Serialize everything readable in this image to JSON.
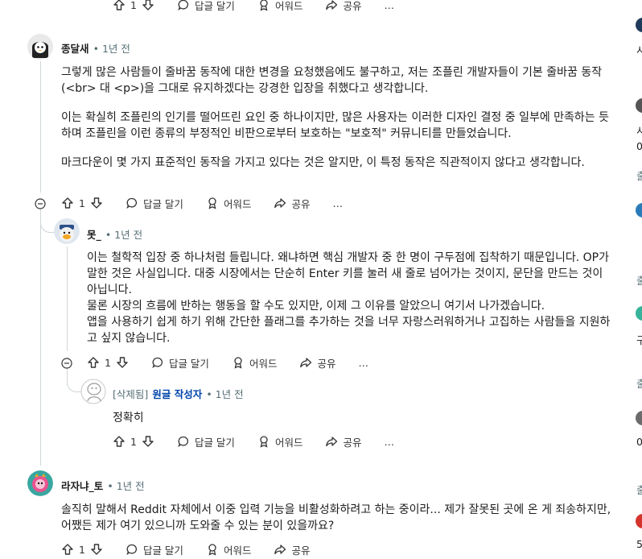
{
  "top_actions": {
    "votes": "1",
    "reply": "답글 달기",
    "award": "어워드",
    "share": "공유",
    "more": "…"
  },
  "comments": [
    {
      "author": "종달새",
      "time": "1년 전",
      "paragraphs": [
        "그렇게 많은 사람들이 줄바꿈 동작에 대한 변경을 요청했음에도 불구하고, 저는 조플린 개발자들이 기본 줄바꿈 동작(<br> 대 <p>)을 그대로 유지하겠다는 강경한 입장을 취했다고 생각합니다.",
        "이는 확실히 조플린의 인기를 떨어뜨린 요인 중 하나이지만, 많은 사용자는 이러한 디자인 결정 중 일부에 만족하는 듯하며 조플린을 이런 종류의 부정적인 비판으로부터 보호하는 \"보호적\" 커뮤니티를 만들었습니다.",
        "마크다운이 몇 가지 표준적인 동작을 가지고 있다는 것은 알지만, 이 특정 동작은 직관적이지 않다고 생각합니다."
      ],
      "votes": "1",
      "reply": "답글 달기",
      "award": "어워드",
      "share": "공유",
      "more": "…"
    },
    {
      "author": "못_",
      "time": "1년 전",
      "lines": [
        "이는 철학적 입장 중 하나처럼 들립니다. 왜냐하면 핵심 개발자 중 한 명이 구두점에 집착하기 때문입니다. OP가 말한 것은 사실입니다. 대중 시장에서는 단순히 Enter 키를 눌러 새 줄로 넘어가는 것이지, 문단을 만드는 것이 아닙니다.",
        "물론 시장의 흐름에 반하는 행동을 할 수도 있지만, 이제 그 이유를 알았으니 여기서 나가겠습니다.",
        "앱을 사용하기 쉽게 하기 위해 간단한 플래그를 추가하는 것을 너무 자랑스러워하거나 고집하는 사람들을 지원하고 싶지 않습니다."
      ],
      "votes": "1",
      "reply": "답글 달기",
      "award": "어워드",
      "share": "공유",
      "more": "…"
    },
    {
      "author": "[삭제됨]",
      "op_badge": "원글 작성자",
      "time": "1년 전",
      "text": "정확히",
      "votes": "1",
      "reply": "답글 달기",
      "award": "어워드",
      "share": "공유",
      "more": "…"
    },
    {
      "author": "라자냐_토",
      "time": "1년 전",
      "text": "솔직히 말해서 Reddit 자체에서 이중 입력 기능을 비활성화하려고 하는 중이라... 제가 잘못된 곳에 온 게 죄송하지만, 어쨌든 제가 여기 있으니까 도와줄 수 있는 분이 있을까요?",
      "votes": "1",
      "reply": "답글 달기",
      "award": "어워드",
      "share": "공유"
    }
  ],
  "right_rail": {
    "snippets": [
      "시",
      "시",
      "0",
      "출",
      "출",
      "구",
      "출",
      "0",
      "출",
      "5"
    ]
  },
  "colors": {
    "meta": "#576f76",
    "op_badge": "#0045ac",
    "thread_line": "#d0d6d8"
  }
}
